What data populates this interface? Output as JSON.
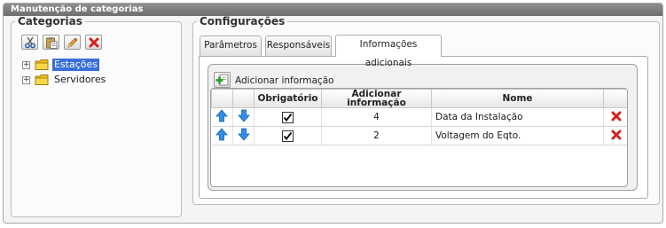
{
  "window": {
    "title": "Manutenção de categorias"
  },
  "categories_panel": {
    "legend": "Categorias",
    "toolbar": [
      {
        "name": "cut-button",
        "icon": "scissors-icon"
      },
      {
        "name": "paste-button",
        "icon": "clipboard-icon"
      },
      {
        "name": "edit-button",
        "icon": "pencil-icon"
      },
      {
        "name": "delete-button",
        "icon": "close-icon"
      }
    ],
    "tree": [
      {
        "label": "Estações",
        "selected": true,
        "expander": "+"
      },
      {
        "label": "Servidores",
        "selected": false,
        "expander": "+"
      }
    ]
  },
  "config_panel": {
    "legend": "Configurações",
    "tabs": [
      {
        "label": "Parâmetros",
        "active": false
      },
      {
        "label": "Responsáveis",
        "active": false
      },
      {
        "label": "Informações adicionais",
        "active": true
      }
    ],
    "add_label": "Adicionar informação",
    "table": {
      "columns": [
        "",
        "",
        "Obrigatório",
        "Adicionar informação",
        "Nome",
        ""
      ],
      "rows": [
        {
          "required": true,
          "value": "4",
          "name": "Data da Instalação"
        },
        {
          "required": true,
          "value": "2",
          "name": "Voltagem do Eqto."
        }
      ]
    }
  },
  "colors": {
    "titlebar": "#7d7d7d",
    "selection": "#3a6ed9",
    "arrow_up": "#2f8fe8",
    "arrow_down": "#2f8fe8",
    "delete": "#d42020",
    "folder": "#f2c418"
  }
}
